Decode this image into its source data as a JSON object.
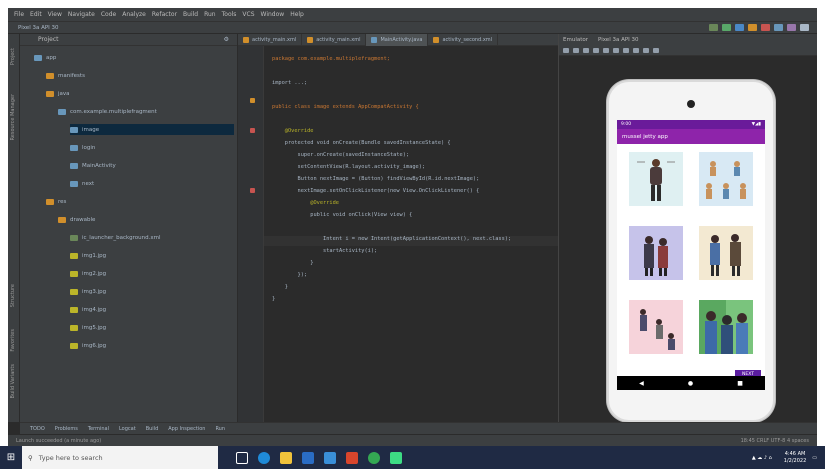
{
  "ide": {
    "project_panel_title": "Project",
    "tool_window_left": [
      "Project",
      "Resource Manager",
      "Structure",
      "Favorites",
      "Build Variants"
    ],
    "editor_tabs": [
      "activity_main.xml",
      "activity_main.xml",
      "MainActivity.java",
      "activity_second.xml"
    ],
    "active_tab_index": 2,
    "emulator_tab": "Emulator",
    "emulator_device": "Pixel 3a API 30",
    "code_lines": [
      {
        "text": "package com.example.multiplefragment;",
        "color": "#cc7832"
      },
      {
        "text": "",
        "color": "#a9b7c6"
      },
      {
        "text": "import ...;",
        "color": "#a9b7c6"
      },
      {
        "text": "",
        "color": "#a9b7c6"
      },
      {
        "text": "public class image extends AppCompatActivity {",
        "color": "#cc7832"
      },
      {
        "text": "",
        "color": "#a9b7c6"
      },
      {
        "text": "    @Override",
        "color": "#bbb529"
      },
      {
        "text": "    protected void onCreate(Bundle savedInstanceState) {",
        "color": "#a9b7c6"
      },
      {
        "text": "        super.onCreate(savedInstanceState);",
        "color": "#a9b7c6"
      },
      {
        "text": "        setContentView(R.layout.activity_image);",
        "color": "#a9b7c6"
      },
      {
        "text": "        Button nextImage = (Button) findViewById(R.id.nextImage);",
        "color": "#a9b7c6"
      },
      {
        "text": "        nextImage.setOnClickListener(new View.OnClickListener() {",
        "color": "#a9b7c6"
      },
      {
        "text": "            @Override",
        "color": "#bbb529"
      },
      {
        "text": "            public void onClick(View view) {",
        "color": "#a9b7c6"
      },
      {
        "text": "",
        "color": "#a9b7c6"
      },
      {
        "text": "                Intent i = new Intent(getApplicationContext(), next.class);",
        "color": "#a9b7c6"
      },
      {
        "text": "                startActivity(i);",
        "color": "#a9b7c6"
      },
      {
        "text": "            }",
        "color": "#a9b7c6"
      },
      {
        "text": "        });",
        "color": "#a9b7c6"
      },
      {
        "text": "    }",
        "color": "#a9b7c6"
      },
      {
        "text": "}",
        "color": "#a9b7c6"
      }
    ],
    "current_line_index": 15,
    "bottom_tools": [
      "TODO",
      "Problems",
      "Terminal",
      "Logcat",
      "Build",
      "App Inspection",
      "Run"
    ],
    "status_left": "Launch succeeded (a minute ago)",
    "status_right": "18:45  CRLF  UTF-8  4 spaces",
    "tree_items": [
      {
        "label": "app",
        "indent": 0,
        "color": "#6897bb"
      },
      {
        "label": "manifests",
        "indent": 1,
        "color": "#d18f2b"
      },
      {
        "label": "java",
        "indent": 1,
        "color": "#d18f2b"
      },
      {
        "label": "com.example.multiplefragment",
        "indent": 2,
        "color": "#6897bb"
      },
      {
        "label": "image",
        "indent": 3,
        "color": "#6897bb",
        "selected": true
      },
      {
        "label": "login",
        "indent": 3,
        "color": "#6897bb"
      },
      {
        "label": "MainActivity",
        "indent": 3,
        "color": "#6897bb"
      },
      {
        "label": "next",
        "indent": 3,
        "color": "#6897bb"
      },
      {
        "label": "res",
        "indent": 1,
        "color": "#d18f2b"
      },
      {
        "label": "drawable",
        "indent": 2,
        "color": "#d18f2b"
      },
      {
        "label": "ic_launcher_background.xml",
        "indent": 3,
        "color": "#6a8759"
      },
      {
        "label": "img1.jpg",
        "indent": 3,
        "color": "#bbb529"
      },
      {
        "label": "img2.jpg",
        "indent": 3,
        "color": "#bbb529"
      },
      {
        "label": "img3.jpg",
        "indent": 3,
        "color": "#bbb529"
      },
      {
        "label": "img4.jpg",
        "indent": 3,
        "color": "#bbb529"
      },
      {
        "label": "img5.jpg",
        "indent": 3,
        "color": "#bbb529"
      },
      {
        "label": "img6.jpg",
        "indent": 3,
        "color": "#bbb529"
      }
    ]
  },
  "phone": {
    "status_time": "9:00",
    "status_icons": "▼◢▮",
    "app_title": "mussel jetty app",
    "next_button": "NEXT",
    "nav_back": "◀",
    "nav_home": "●",
    "nav_recent": "■"
  },
  "taskbar": {
    "search_placeholder": "Type here to search",
    "clock_time": "4:46 AM",
    "clock_date": "1/2/2022"
  }
}
